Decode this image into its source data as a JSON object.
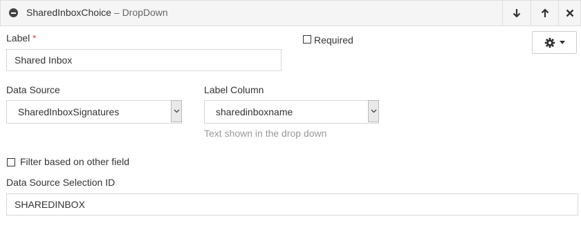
{
  "header": {
    "title": "SharedInboxChoice",
    "separator": " – ",
    "subtitle": "DropDown",
    "icons": [
      "minus-circle-icon",
      "arrow-down-icon",
      "arrow-up-icon",
      "close-icon"
    ]
  },
  "label_field": {
    "label": "Label",
    "required_marker": "*",
    "value": "Shared Inbox"
  },
  "required_checkbox": {
    "label": "Required",
    "checked": false
  },
  "settings": {
    "icon": "gear-icon",
    "caret": "caret-down-icon"
  },
  "data_source": {
    "label": "Data Source",
    "value": "SharedInboxSignatures"
  },
  "label_column": {
    "label": "Label Column",
    "value": "sharedinboxname",
    "help": "Text shown in the drop down"
  },
  "filter_checkbox": {
    "label": "Filter based on other field",
    "checked": false
  },
  "selection_id": {
    "label": "Data Source Selection ID",
    "value": "SHAREDINBOX"
  },
  "colors": {
    "header_bg": "#f5f5f5",
    "border": "#dddddd",
    "required": "#d9534f",
    "help_text": "#999999"
  }
}
